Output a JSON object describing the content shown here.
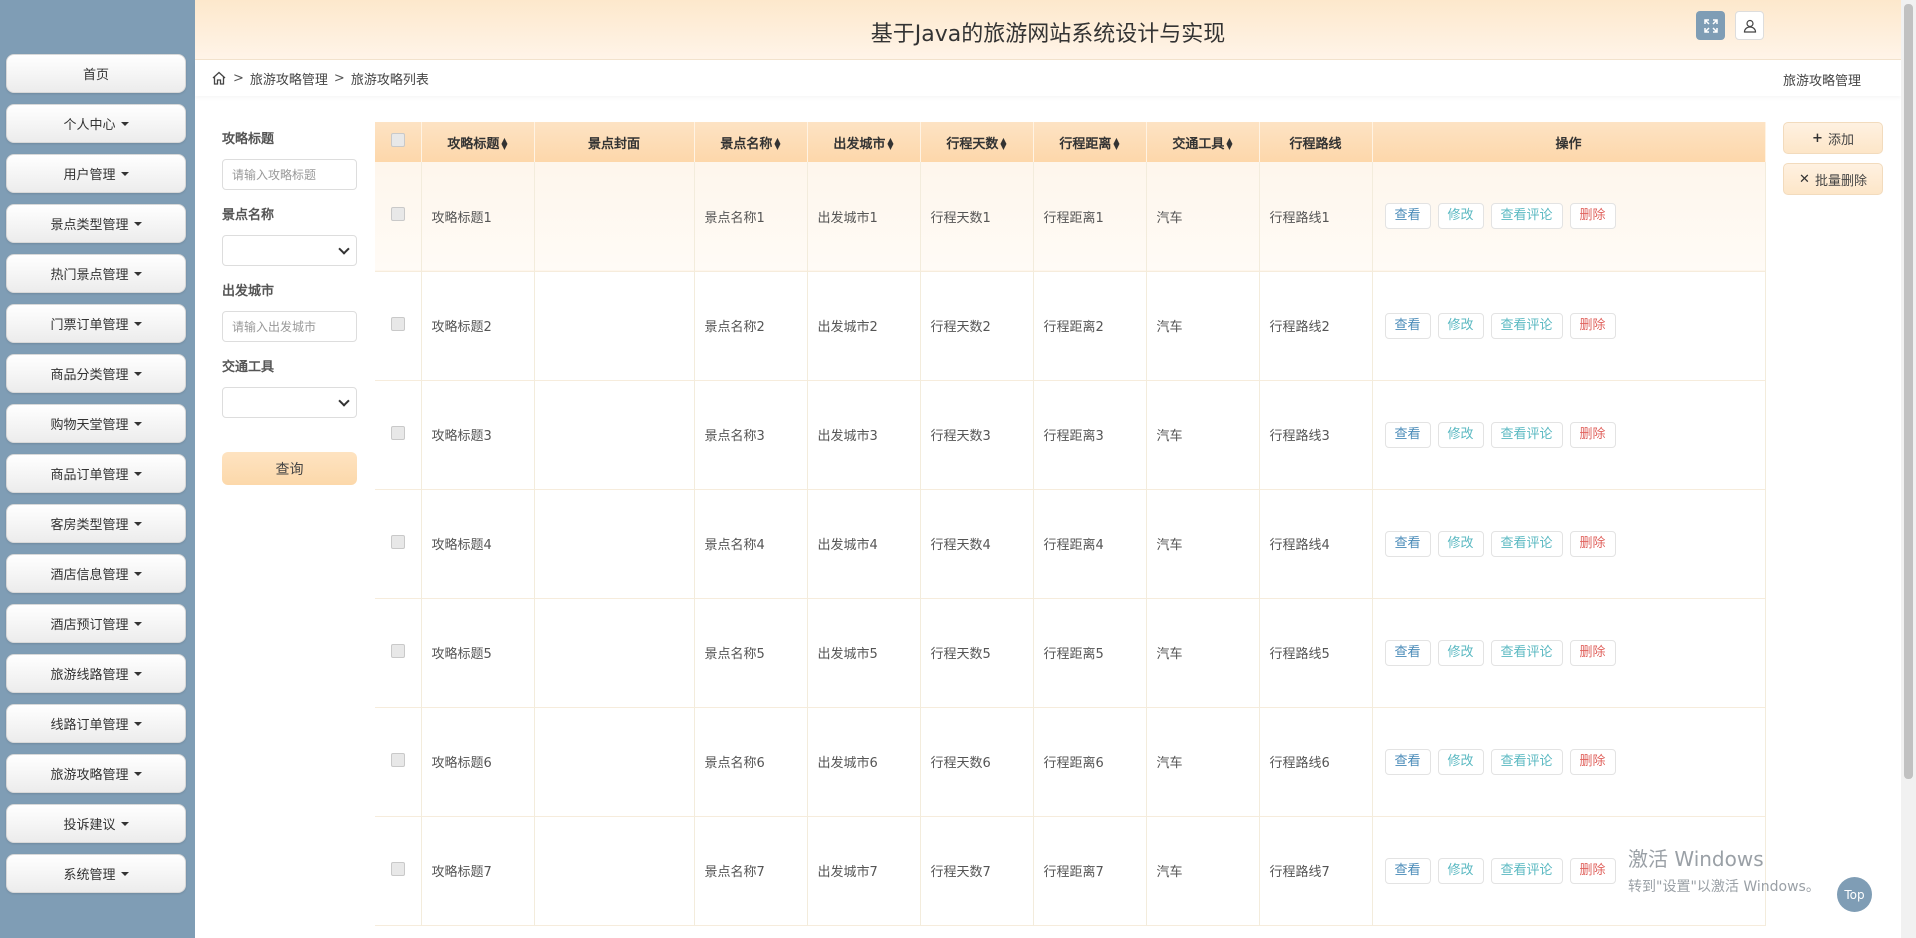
{
  "header": {
    "title": "基于Java的旅游网站系统设计与实现"
  },
  "sidebar": {
    "items": [
      {
        "label": "首页",
        "dropdown": false
      },
      {
        "label": "个人中心",
        "dropdown": true
      },
      {
        "label": "用户管理",
        "dropdown": true
      },
      {
        "label": "景点类型管理",
        "dropdown": true
      },
      {
        "label": "热门景点管理",
        "dropdown": true
      },
      {
        "label": "门票订单管理",
        "dropdown": true
      },
      {
        "label": "商品分类管理",
        "dropdown": true
      },
      {
        "label": "购物天堂管理",
        "dropdown": true
      },
      {
        "label": "商品订单管理",
        "dropdown": true
      },
      {
        "label": "客房类型管理",
        "dropdown": true
      },
      {
        "label": "酒店信息管理",
        "dropdown": true
      },
      {
        "label": "酒店预订管理",
        "dropdown": true
      },
      {
        "label": "旅游线路管理",
        "dropdown": true
      },
      {
        "label": "线路订单管理",
        "dropdown": true
      },
      {
        "label": "旅游攻略管理",
        "dropdown": true
      },
      {
        "label": "投诉建议",
        "dropdown": true
      },
      {
        "label": "系统管理",
        "dropdown": true
      }
    ]
  },
  "breadcrumb": {
    "level1": "旅游攻略管理",
    "level2": "旅游攻略列表",
    "right": "旅游攻略管理"
  },
  "search": {
    "title_label": "攻略标题",
    "title_placeholder": "请输入攻略标题",
    "spot_label": "景点名称",
    "city_label": "出发城市",
    "city_placeholder": "请输入出发城市",
    "transport_label": "交通工具",
    "query_button": "查询"
  },
  "actions": {
    "add": "添加",
    "batch_delete": "批量删除"
  },
  "table": {
    "columns": [
      "攻略标题",
      "景点封面",
      "景点名称",
      "出发城市",
      "行程天数",
      "行程距离",
      "交通工具",
      "行程路线",
      "操作"
    ],
    "ops": {
      "view": "查看",
      "edit": "修改",
      "comments": "查看评论",
      "delete": "删除"
    },
    "rows": [
      [
        "攻略标题1",
        "",
        "景点名称1",
        "出发城市1",
        "行程天数1",
        "行程距离1",
        "汽车",
        "行程路线1"
      ],
      [
        "攻略标题2",
        "",
        "景点名称2",
        "出发城市2",
        "行程天数2",
        "行程距离2",
        "汽车",
        "行程路线2"
      ],
      [
        "攻略标题3",
        "",
        "景点名称3",
        "出发城市3",
        "行程天数3",
        "行程距离3",
        "汽车",
        "行程路线3"
      ],
      [
        "攻略标题4",
        "",
        "景点名称4",
        "出发城市4",
        "行程天数4",
        "行程距离4",
        "汽车",
        "行程路线4"
      ],
      [
        "攻略标题5",
        "",
        "景点名称5",
        "出发城市5",
        "行程天数5",
        "行程距离5",
        "汽车",
        "行程路线5"
      ],
      [
        "攻略标题6",
        "",
        "景点名称6",
        "出发城市6",
        "行程天数6",
        "行程距离6",
        "汽车",
        "行程路线6"
      ],
      [
        "攻略标题7",
        "",
        "景点名称7",
        "出发城市7",
        "行程天数7",
        "行程距离7",
        "汽车",
        "行程路线7"
      ]
    ]
  },
  "watermark": {
    "line1": "激活 Windows",
    "line2": "转到\"设置\"以激活 Windows。"
  },
  "top_button": "Top",
  "colors": {
    "sidebar": "#7f9db5",
    "header": "#fde8cc",
    "accent": "#fdd7aa"
  }
}
